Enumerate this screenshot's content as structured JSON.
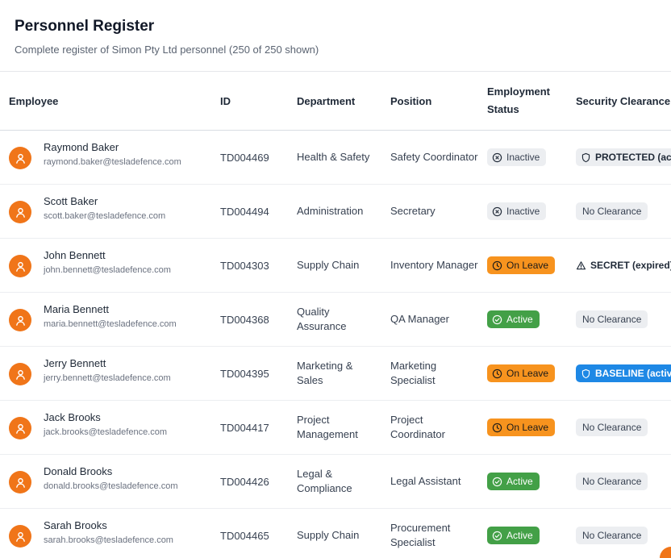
{
  "header": {
    "title": "Personnel Register",
    "subtitle": "Complete register of Simon Pty Ltd personnel (250 of 250 shown)"
  },
  "columns": {
    "employee": "Employee",
    "id": "ID",
    "department": "Department",
    "position": "Position",
    "employment_status": "Employment Status",
    "security_clearance": "Security Clearance"
  },
  "rows": [
    {
      "name": "Raymond Baker",
      "email": "raymond.baker@tesladefence.com",
      "id": "TD004469",
      "department": "Health & Safety",
      "position": "Safety Coordinator",
      "status": "Inactive",
      "status_kind": "inactive",
      "clearance": "PROTECTED (active)",
      "clearance_kind": "protected"
    },
    {
      "name": "Scott Baker",
      "email": "scott.baker@tesladefence.com",
      "id": "TD004494",
      "department": "Administration",
      "position": "Secretary",
      "status": "Inactive",
      "status_kind": "inactive",
      "clearance": "No Clearance",
      "clearance_kind": "none"
    },
    {
      "name": "John Bennett",
      "email": "john.bennett@tesladefence.com",
      "id": "TD004303",
      "department": "Supply Chain",
      "position": "Inventory Manager",
      "status": "On Leave",
      "status_kind": "leave",
      "clearance": "SECRET (expired)",
      "clearance_kind": "expired"
    },
    {
      "name": "Maria Bennett",
      "email": "maria.bennett@tesladefence.com",
      "id": "TD004368",
      "department": "Quality Assurance",
      "position": "QA Manager",
      "status": "Active",
      "status_kind": "active",
      "clearance": "No Clearance",
      "clearance_kind": "none"
    },
    {
      "name": "Jerry Bennett",
      "email": "jerry.bennett@tesladefence.com",
      "id": "TD004395",
      "department": "Marketing & Sales",
      "position": "Marketing Specialist",
      "status": "On Leave",
      "status_kind": "leave",
      "clearance": "BASELINE (active)",
      "clearance_kind": "baseline"
    },
    {
      "name": "Jack Brooks",
      "email": "jack.brooks@tesladefence.com",
      "id": "TD004417",
      "department": "Project Management",
      "position": "Project Coordinator",
      "status": "On Leave",
      "status_kind": "leave",
      "clearance": "No Clearance",
      "clearance_kind": "none"
    },
    {
      "name": "Donald Brooks",
      "email": "donald.brooks@tesladefence.com",
      "id": "TD004426",
      "department": "Legal & Compliance",
      "position": "Legal Assistant",
      "status": "Active",
      "status_kind": "active",
      "clearance": "No Clearance",
      "clearance_kind": "none"
    },
    {
      "name": "Sarah Brooks",
      "email": "sarah.brooks@tesladefence.com",
      "id": "TD004465",
      "department": "Supply Chain",
      "position": "Procurement Specialist",
      "status": "Active",
      "status_kind": "active",
      "clearance": "No Clearance",
      "clearance_kind": "none"
    }
  ],
  "colors": {
    "avatar": "#f07519",
    "status_active": "#43a047",
    "status_leave": "#f7931e",
    "status_inactive": "#eceef1",
    "clearance_baseline": "#1e88e5"
  },
  "icons": {
    "avatar": "user-icon",
    "inactive": "x-circle-icon",
    "leave": "clock-icon",
    "active": "check-circle-icon",
    "protected": "shield-icon",
    "expired": "warning-triangle-icon",
    "baseline": "shield-icon"
  }
}
